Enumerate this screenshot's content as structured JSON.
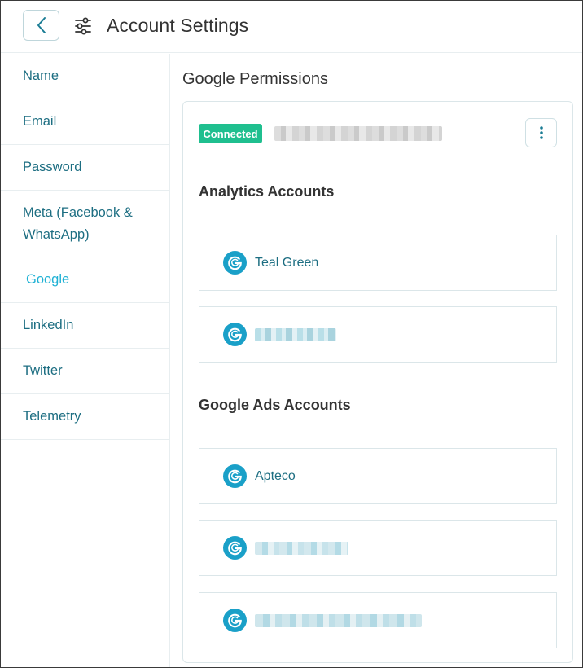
{
  "header": {
    "title": "Account Settings",
    "back_icon": "chevron-left-icon",
    "settings_icon": "sliders-icon"
  },
  "sidebar": {
    "items": [
      {
        "label": "Name"
      },
      {
        "label": "Email"
      },
      {
        "label": "Password"
      },
      {
        "label": "Meta (Facebook & WhatsApp)"
      },
      {
        "label": "Google",
        "active": true
      },
      {
        "label": "LinkedIn"
      },
      {
        "label": "Twitter"
      },
      {
        "label": "Telemetry"
      }
    ]
  },
  "main": {
    "section_title": "Google Permissions",
    "status_badge": "Connected",
    "analytics_heading": "Analytics Accounts",
    "ads_heading": "Google Ads Accounts",
    "analytics_accounts": [
      {
        "label": "Teal Green"
      },
      {
        "label": ""
      }
    ],
    "ads_accounts": [
      {
        "label": "Apteco"
      },
      {
        "label": ""
      },
      {
        "label": ""
      }
    ]
  },
  "colors": {
    "accent": "#1d6e82",
    "active": "#1fb1d4",
    "badge": "#1fbf8f",
    "google_icon": "#1aa0c8"
  }
}
